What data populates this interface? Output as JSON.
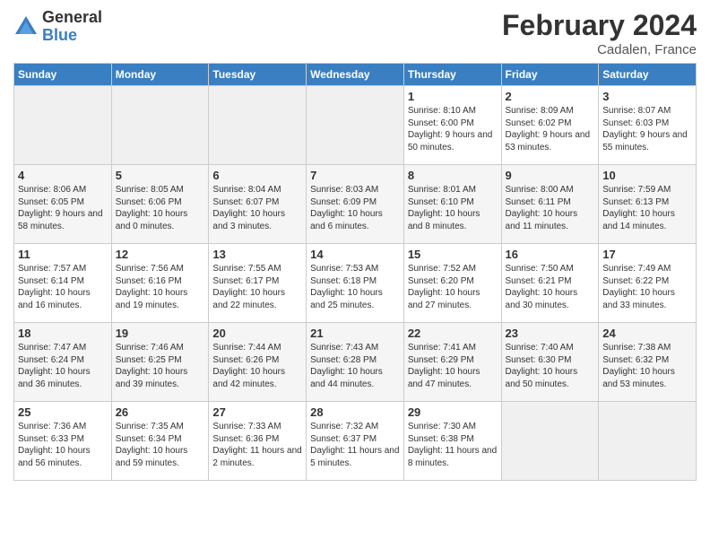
{
  "header": {
    "logo_general": "General",
    "logo_blue": "Blue",
    "month_year": "February 2024",
    "location": "Cadalen, France"
  },
  "days_of_week": [
    "Sunday",
    "Monday",
    "Tuesday",
    "Wednesday",
    "Thursday",
    "Friday",
    "Saturday"
  ],
  "weeks": [
    [
      {
        "day": "",
        "info": ""
      },
      {
        "day": "",
        "info": ""
      },
      {
        "day": "",
        "info": ""
      },
      {
        "day": "",
        "info": ""
      },
      {
        "day": "1",
        "info": "Sunrise: 8:10 AM\nSunset: 6:00 PM\nDaylight: 9 hours\nand 50 minutes."
      },
      {
        "day": "2",
        "info": "Sunrise: 8:09 AM\nSunset: 6:02 PM\nDaylight: 9 hours\nand 53 minutes."
      },
      {
        "day": "3",
        "info": "Sunrise: 8:07 AM\nSunset: 6:03 PM\nDaylight: 9 hours\nand 55 minutes."
      }
    ],
    [
      {
        "day": "4",
        "info": "Sunrise: 8:06 AM\nSunset: 6:05 PM\nDaylight: 9 hours\nand 58 minutes."
      },
      {
        "day": "5",
        "info": "Sunrise: 8:05 AM\nSunset: 6:06 PM\nDaylight: 10 hours\nand 0 minutes."
      },
      {
        "day": "6",
        "info": "Sunrise: 8:04 AM\nSunset: 6:07 PM\nDaylight: 10 hours\nand 3 minutes."
      },
      {
        "day": "7",
        "info": "Sunrise: 8:03 AM\nSunset: 6:09 PM\nDaylight: 10 hours\nand 6 minutes."
      },
      {
        "day": "8",
        "info": "Sunrise: 8:01 AM\nSunset: 6:10 PM\nDaylight: 10 hours\nand 8 minutes."
      },
      {
        "day": "9",
        "info": "Sunrise: 8:00 AM\nSunset: 6:11 PM\nDaylight: 10 hours\nand 11 minutes."
      },
      {
        "day": "10",
        "info": "Sunrise: 7:59 AM\nSunset: 6:13 PM\nDaylight: 10 hours\nand 14 minutes."
      }
    ],
    [
      {
        "day": "11",
        "info": "Sunrise: 7:57 AM\nSunset: 6:14 PM\nDaylight: 10 hours\nand 16 minutes."
      },
      {
        "day": "12",
        "info": "Sunrise: 7:56 AM\nSunset: 6:16 PM\nDaylight: 10 hours\nand 19 minutes."
      },
      {
        "day": "13",
        "info": "Sunrise: 7:55 AM\nSunset: 6:17 PM\nDaylight: 10 hours\nand 22 minutes."
      },
      {
        "day": "14",
        "info": "Sunrise: 7:53 AM\nSunset: 6:18 PM\nDaylight: 10 hours\nand 25 minutes."
      },
      {
        "day": "15",
        "info": "Sunrise: 7:52 AM\nSunset: 6:20 PM\nDaylight: 10 hours\nand 27 minutes."
      },
      {
        "day": "16",
        "info": "Sunrise: 7:50 AM\nSunset: 6:21 PM\nDaylight: 10 hours\nand 30 minutes."
      },
      {
        "day": "17",
        "info": "Sunrise: 7:49 AM\nSunset: 6:22 PM\nDaylight: 10 hours\nand 33 minutes."
      }
    ],
    [
      {
        "day": "18",
        "info": "Sunrise: 7:47 AM\nSunset: 6:24 PM\nDaylight: 10 hours\nand 36 minutes."
      },
      {
        "day": "19",
        "info": "Sunrise: 7:46 AM\nSunset: 6:25 PM\nDaylight: 10 hours\nand 39 minutes."
      },
      {
        "day": "20",
        "info": "Sunrise: 7:44 AM\nSunset: 6:26 PM\nDaylight: 10 hours\nand 42 minutes."
      },
      {
        "day": "21",
        "info": "Sunrise: 7:43 AM\nSunset: 6:28 PM\nDaylight: 10 hours\nand 44 minutes."
      },
      {
        "day": "22",
        "info": "Sunrise: 7:41 AM\nSunset: 6:29 PM\nDaylight: 10 hours\nand 47 minutes."
      },
      {
        "day": "23",
        "info": "Sunrise: 7:40 AM\nSunset: 6:30 PM\nDaylight: 10 hours\nand 50 minutes."
      },
      {
        "day": "24",
        "info": "Sunrise: 7:38 AM\nSunset: 6:32 PM\nDaylight: 10 hours\nand 53 minutes."
      }
    ],
    [
      {
        "day": "25",
        "info": "Sunrise: 7:36 AM\nSunset: 6:33 PM\nDaylight: 10 hours\nand 56 minutes."
      },
      {
        "day": "26",
        "info": "Sunrise: 7:35 AM\nSunset: 6:34 PM\nDaylight: 10 hours\nand 59 minutes."
      },
      {
        "day": "27",
        "info": "Sunrise: 7:33 AM\nSunset: 6:36 PM\nDaylight: 11 hours\nand 2 minutes."
      },
      {
        "day": "28",
        "info": "Sunrise: 7:32 AM\nSunset: 6:37 PM\nDaylight: 11 hours\nand 5 minutes."
      },
      {
        "day": "29",
        "info": "Sunrise: 7:30 AM\nSunset: 6:38 PM\nDaylight: 11 hours\nand 8 minutes."
      },
      {
        "day": "",
        "info": ""
      },
      {
        "day": "",
        "info": ""
      }
    ]
  ]
}
